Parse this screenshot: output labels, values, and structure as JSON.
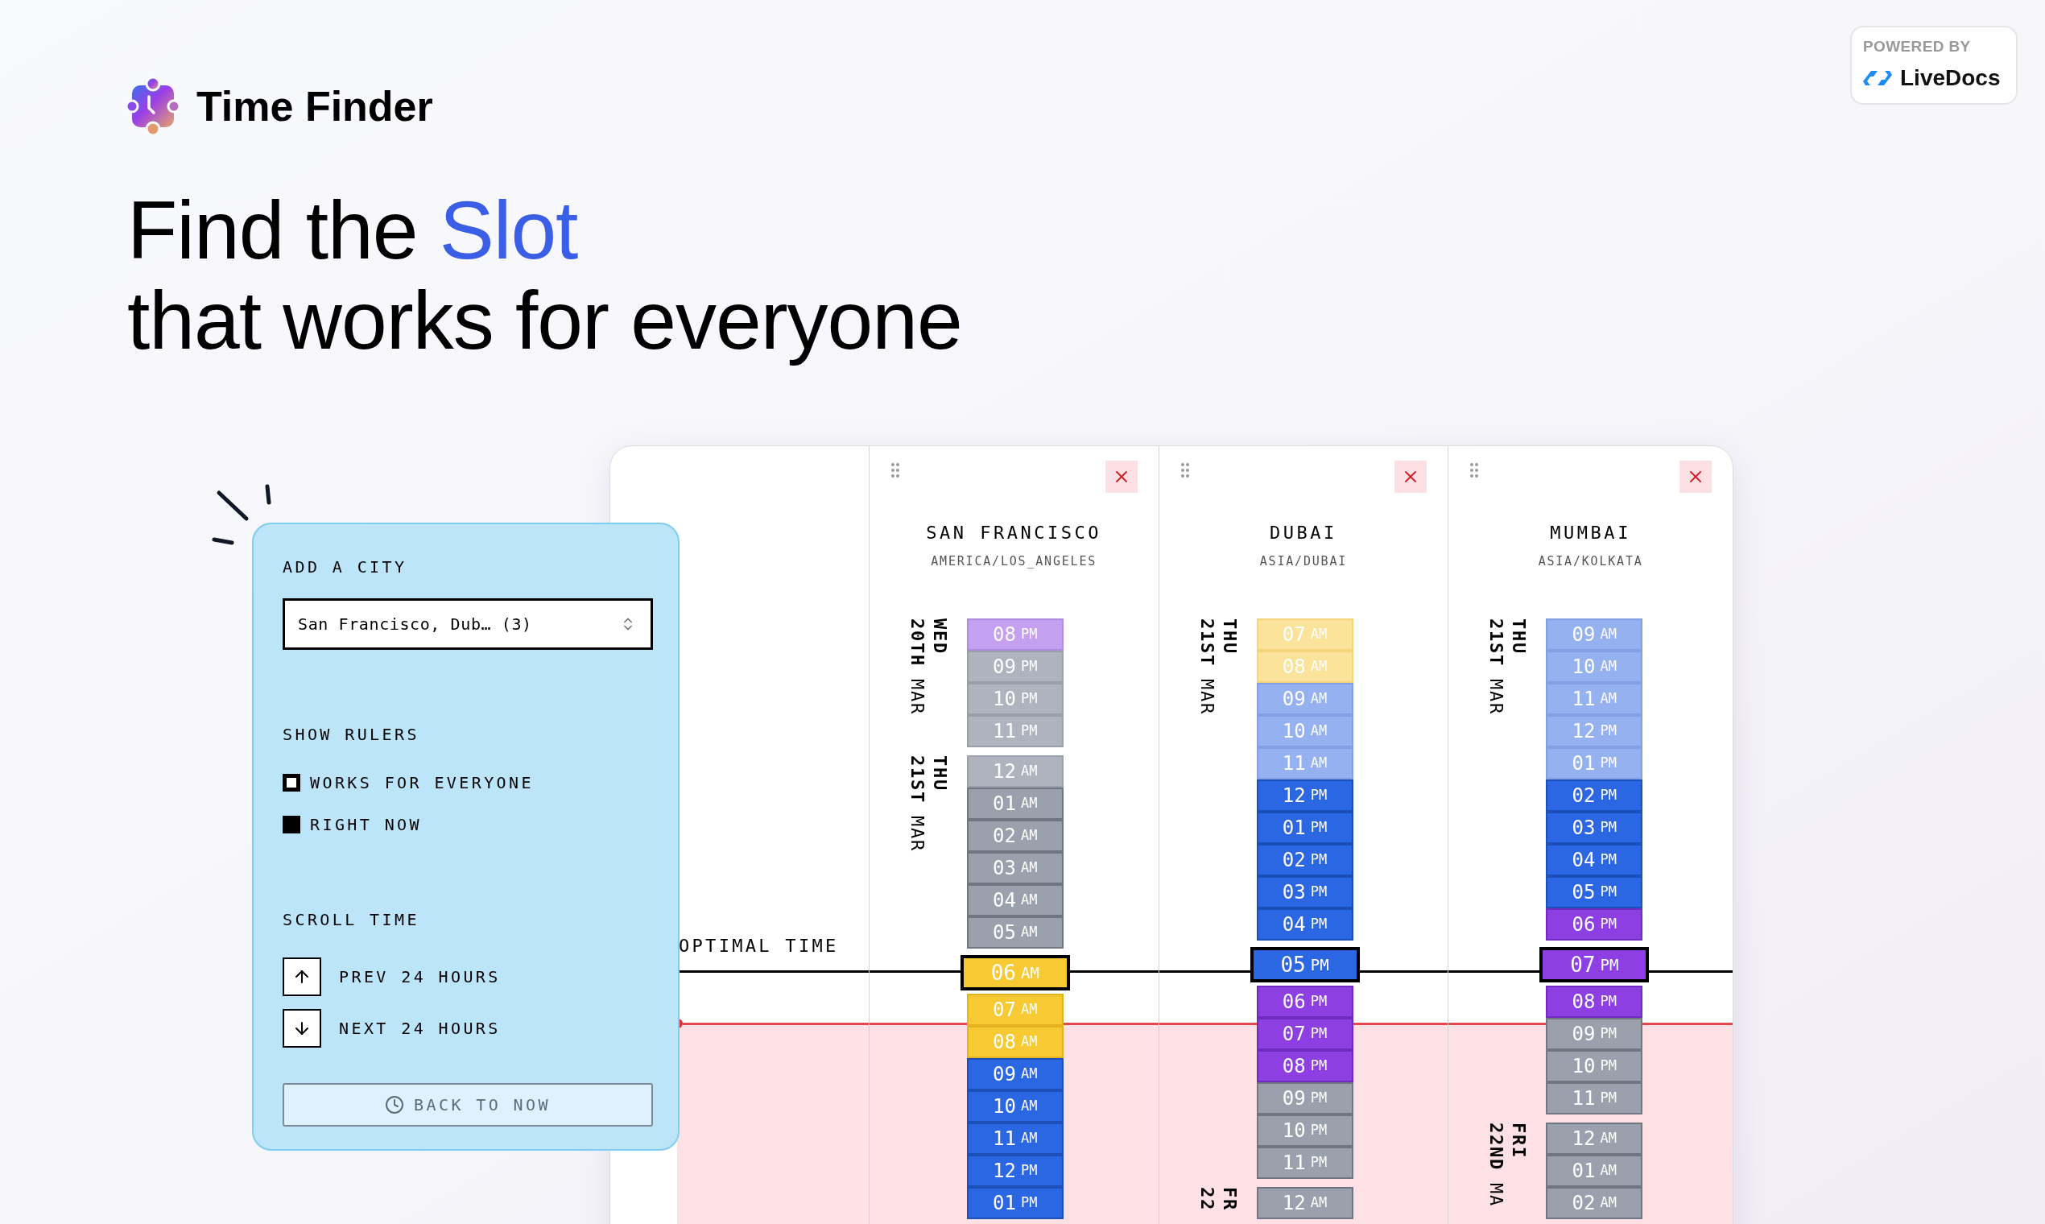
{
  "app": {
    "name": "Time Finder"
  },
  "badge": {
    "caption": "POWERED BY",
    "brand": "LiveDocs"
  },
  "headline": {
    "lead": "Find the",
    "highlight": "Slot",
    "rest": "that works for everyone"
  },
  "panel": {
    "add_city_label": "ADD A CITY",
    "city_select": {
      "value": "San Francisco, Dub… (3)"
    },
    "rulers_label": "SHOW RULERS",
    "rulers": [
      {
        "label": "WORKS FOR EVERYONE",
        "kind": "outline"
      },
      {
        "label": "RIGHT NOW",
        "kind": "solid"
      }
    ],
    "scroll_label": "SCROLL TIME",
    "scroll_buttons": [
      {
        "label": "PREV 24 HOURS",
        "kind": "up"
      },
      {
        "label": "NEXT 24 HOURS",
        "kind": "down"
      }
    ],
    "back_button": "BACK TO NOW"
  },
  "board": {
    "optimal_label": "OPTIMAL TIME",
    "columns": [
      {
        "city": "SAN FRANCISCO",
        "timezone": "AMERICA/LOS_ANGELES",
        "days": [
          {
            "weekday": "WED",
            "date": "20TH",
            "month": "MAR",
            "hours": [
              {
                "hour": "08",
                "period": "PM",
                "kind": "evening",
                "faded": true,
                "selected": false
              },
              {
                "hour": "09",
                "period": "PM",
                "kind": "night",
                "faded": true,
                "selected": false
              },
              {
                "hour": "10",
                "period": "PM",
                "kind": "night",
                "faded": true,
                "selected": false
              },
              {
                "hour": "11",
                "period": "PM",
                "kind": "night",
                "faded": true,
                "selected": false
              }
            ]
          },
          {
            "weekday": "THU",
            "date": "21ST",
            "month": "MAR",
            "hours": [
              {
                "hour": "12",
                "period": "AM",
                "kind": "night",
                "faded": true,
                "selected": false
              },
              {
                "hour": "01",
                "period": "AM",
                "kind": "night",
                "faded": false,
                "selected": false
              },
              {
                "hour": "02",
                "period": "AM",
                "kind": "night",
                "faded": false,
                "selected": false
              },
              {
                "hour": "03",
                "period": "AM",
                "kind": "night",
                "faded": false,
                "selected": false
              },
              {
                "hour": "04",
                "period": "AM",
                "kind": "night",
                "faded": false,
                "selected": false
              },
              {
                "hour": "05",
                "period": "AM",
                "kind": "night",
                "faded": false,
                "selected": false
              },
              {
                "hour": "06",
                "period": "AM",
                "kind": "morning",
                "faded": false,
                "selected": true
              },
              {
                "hour": "07",
                "period": "AM",
                "kind": "morning",
                "faded": false,
                "selected": false
              },
              {
                "hour": "08",
                "period": "AM",
                "kind": "morning",
                "faded": false,
                "selected": false
              },
              {
                "hour": "09",
                "period": "AM",
                "kind": "work",
                "faded": false,
                "selected": false
              },
              {
                "hour": "10",
                "period": "AM",
                "kind": "work",
                "faded": false,
                "selected": false
              },
              {
                "hour": "11",
                "period": "AM",
                "kind": "work",
                "faded": false,
                "selected": false
              },
              {
                "hour": "12",
                "period": "PM",
                "kind": "work",
                "faded": false,
                "selected": false
              },
              {
                "hour": "01",
                "period": "PM",
                "kind": "work",
                "faded": false,
                "selected": false
              }
            ]
          }
        ]
      },
      {
        "city": "DUBAI",
        "timezone": "ASIA/DUBAI",
        "days": [
          {
            "weekday": "THU",
            "date": "21ST",
            "month": "MAR",
            "hours": [
              {
                "hour": "07",
                "period": "AM",
                "kind": "morning",
                "faded": true,
                "selected": false
              },
              {
                "hour": "08",
                "period": "AM",
                "kind": "morning",
                "faded": true,
                "selected": false
              },
              {
                "hour": "09",
                "period": "AM",
                "kind": "work",
                "faded": true,
                "selected": false
              },
              {
                "hour": "10",
                "period": "AM",
                "kind": "work",
                "faded": true,
                "selected": false
              },
              {
                "hour": "11",
                "period": "AM",
                "kind": "work",
                "faded": true,
                "selected": false
              },
              {
                "hour": "12",
                "period": "PM",
                "kind": "work",
                "faded": false,
                "selected": false
              },
              {
                "hour": "01",
                "period": "PM",
                "kind": "work",
                "faded": false,
                "selected": false
              },
              {
                "hour": "02",
                "period": "PM",
                "kind": "work",
                "faded": false,
                "selected": false
              },
              {
                "hour": "03",
                "period": "PM",
                "kind": "work",
                "faded": false,
                "selected": false
              },
              {
                "hour": "04",
                "period": "PM",
                "kind": "work",
                "faded": false,
                "selected": false
              },
              {
                "hour": "05",
                "period": "PM",
                "kind": "work",
                "faded": false,
                "selected": true
              },
              {
                "hour": "06",
                "period": "PM",
                "kind": "evening",
                "faded": false,
                "selected": false
              },
              {
                "hour": "07",
                "period": "PM",
                "kind": "evening",
                "faded": false,
                "selected": false
              },
              {
                "hour": "08",
                "period": "PM",
                "kind": "evening",
                "faded": false,
                "selected": false
              },
              {
                "hour": "09",
                "period": "PM",
                "kind": "night",
                "faded": false,
                "selected": false
              },
              {
                "hour": "10",
                "period": "PM",
                "kind": "night",
                "faded": false,
                "selected": false
              },
              {
                "hour": "11",
                "period": "PM",
                "kind": "night",
                "faded": false,
                "selected": false
              }
            ]
          },
          {
            "weekday": "FR",
            "date": "22",
            "hours": [
              {
                "hour": "12",
                "period": "AM",
                "kind": "night",
                "faded": false,
                "selected": false
              }
            ]
          }
        ]
      },
      {
        "city": "MUMBAI",
        "timezone": "ASIA/KOLKATA",
        "days": [
          {
            "weekday": "THU",
            "date": "21ST",
            "month": "MAR",
            "hours": [
              {
                "hour": "09",
                "period": "AM",
                "kind": "work",
                "faded": true,
                "selected": false
              },
              {
                "hour": "10",
                "period": "AM",
                "kind": "work",
                "faded": true,
                "selected": false
              },
              {
                "hour": "11",
                "period": "AM",
                "kind": "work",
                "faded": true,
                "selected": false
              },
              {
                "hour": "12",
                "period": "PM",
                "kind": "work",
                "faded": true,
                "selected": false
              },
              {
                "hour": "01",
                "period": "PM",
                "kind": "work",
                "faded": true,
                "selected": false
              },
              {
                "hour": "02",
                "period": "PM",
                "kind": "work",
                "faded": false,
                "selected": false
              },
              {
                "hour": "03",
                "period": "PM",
                "kind": "work",
                "faded": false,
                "selected": false
              },
              {
                "hour": "04",
                "period": "PM",
                "kind": "work",
                "faded": false,
                "selected": false
              },
              {
                "hour": "05",
                "period": "PM",
                "kind": "work",
                "faded": false,
                "selected": false
              },
              {
                "hour": "06",
                "period": "PM",
                "kind": "evening",
                "faded": false,
                "selected": false
              },
              {
                "hour": "07",
                "period": "PM",
                "kind": "evening",
                "faded": false,
                "selected": true
              },
              {
                "hour": "08",
                "period": "PM",
                "kind": "evening",
                "faded": false,
                "selected": false
              },
              {
                "hour": "09",
                "period": "PM",
                "kind": "night",
                "faded": false,
                "selected": false
              },
              {
                "hour": "10",
                "period": "PM",
                "kind": "night",
                "faded": false,
                "selected": false
              },
              {
                "hour": "11",
                "period": "PM",
                "kind": "night",
                "faded": false,
                "selected": false
              }
            ]
          },
          {
            "weekday": "FRI",
            "date": "22ND",
            "month": "MA",
            "hours": [
              {
                "hour": "12",
                "period": "AM",
                "kind": "night",
                "faded": false,
                "selected": false
              },
              {
                "hour": "01",
                "period": "AM",
                "kind": "night",
                "faded": false,
                "selected": false
              },
              {
                "hour": "02",
                "period": "AM",
                "kind": "night",
                "faded": false,
                "selected": false
              }
            ]
          }
        ]
      }
    ]
  }
}
